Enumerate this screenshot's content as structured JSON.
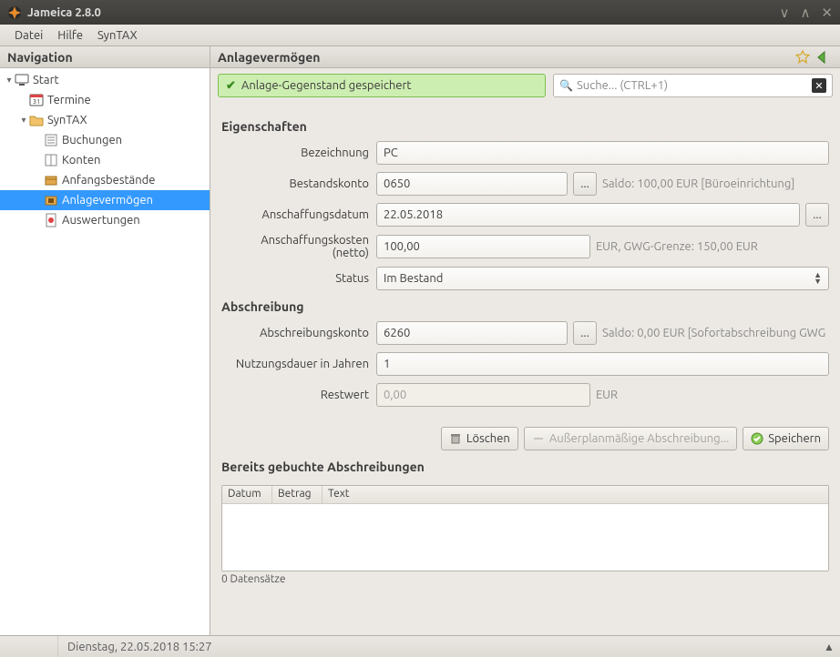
{
  "window": {
    "title": "Jameica 2.8.0"
  },
  "menubar": {
    "items": [
      "Datei",
      "Hilfe",
      "SynTAX"
    ]
  },
  "sidebar": {
    "title": "Navigation",
    "tree": {
      "start": "Start",
      "termine": "Termine",
      "syntax": "SynTAX",
      "buchungen": "Buchungen",
      "konten": "Konten",
      "anfang": "Anfangsbestände",
      "anlage": "Anlagevermögen",
      "auswert": "Auswertungen"
    }
  },
  "main": {
    "title": "Anlagevermögen",
    "success": "Anlage-Gegenstand gespeichert",
    "search_placeholder": "Suche...  (CTRL+1)",
    "section1": "Eigenschaften",
    "fields": {
      "bezeichnung_label": "Bezeichnung",
      "bezeichnung_value": "PC",
      "bestandskonto_label": "Bestandskonto",
      "bestandskonto_value": "0650",
      "bestandskonto_hint": "Saldo: 100,00 EUR [Büroeinrichtung]",
      "anschaffungsdatum_label": "Anschaffungsdatum",
      "anschaffungsdatum_value": "22.05.2018",
      "anschaffungskosten_label": "Anschaffungskosten (netto)",
      "anschaffungskosten_value": "100,00",
      "anschaffungskosten_hint": "EUR, GWG-Grenze: 150,00 EUR",
      "status_label": "Status",
      "status_value": "Im Bestand"
    },
    "section2": "Abschreibung",
    "fields2": {
      "abschreibungskonto_label": "Abschreibungskonto",
      "abschreibungskonto_value": "6260",
      "abschreibungskonto_hint": "Saldo: 0,00 EUR [Sofortabschreibung GWG",
      "nutzungsdauer_label": "Nutzungsdauer in Jahren",
      "nutzungsdauer_value": "1",
      "restwert_label": "Restwert",
      "restwert_value": "0,00",
      "restwert_hint": "EUR"
    },
    "buttons": {
      "delete": "Löschen",
      "extra": "Außerplanmäßige Abschreibung...",
      "save": "Speichern"
    },
    "section3": "Bereits gebuchte Abschreibungen",
    "table": {
      "cols": [
        "Datum",
        "Betrag",
        "Text"
      ],
      "footer": "0 Datensätze"
    }
  },
  "statusbar": {
    "date": "Dienstag, 22.05.2018 15:27"
  }
}
